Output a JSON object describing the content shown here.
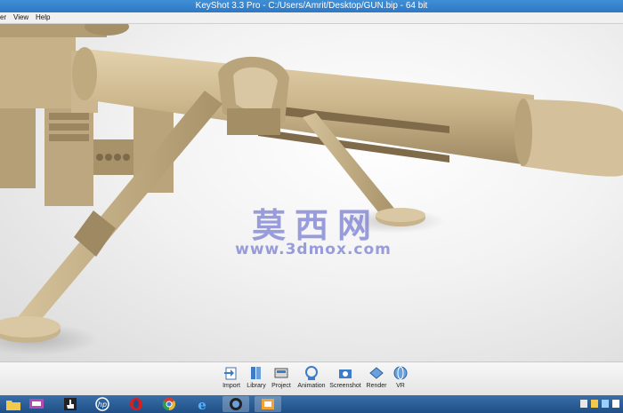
{
  "window": {
    "title": "KeyShot 3.3 Pro  -  C:/Users/Amrit/Desktop/GUN.bip  -  64 bit"
  },
  "menu": [
    {
      "label": "er"
    },
    {
      "label": "View"
    },
    {
      "label": "Help"
    }
  ],
  "watermark": {
    "chinese": "莫西网",
    "url": "www.3dmox.com"
  },
  "toolbar": [
    {
      "label": "Import",
      "icon": "import-icon"
    },
    {
      "label": "Library",
      "icon": "library-icon"
    },
    {
      "label": "Project",
      "icon": "project-icon"
    },
    {
      "label": "Animation",
      "icon": "animation-icon"
    },
    {
      "label": "Screenshot",
      "icon": "screenshot-icon"
    },
    {
      "label": "Render",
      "icon": "render-icon"
    },
    {
      "label": "VR",
      "icon": "vr-icon"
    }
  ],
  "taskbar": [
    {
      "icon": "folder-icon"
    },
    {
      "icon": "presentation-icon"
    },
    {
      "icon": "hand-cursor-icon"
    },
    {
      "icon": "hp-icon"
    },
    {
      "icon": "opera-icon"
    },
    {
      "icon": "chrome-icon"
    },
    {
      "icon": "internet-explorer-icon"
    },
    {
      "icon": "keyshot-icon"
    },
    {
      "icon": "paint-icon"
    }
  ],
  "colors": {
    "model": "#c8b48c",
    "titlebar": "#2f78c4",
    "taskbar": "#1f4f86"
  }
}
